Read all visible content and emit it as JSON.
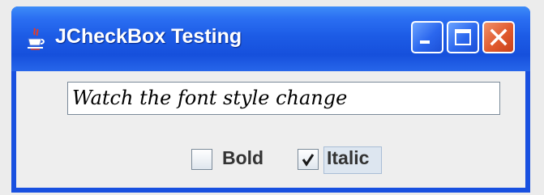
{
  "window": {
    "title": "JCheckBox Testing",
    "icon": "java-cup-icon",
    "controls": [
      "minimize-icon",
      "maximize-icon",
      "close-icon"
    ]
  },
  "textfield": {
    "value": "Watch the font style change"
  },
  "checkboxes": [
    {
      "label": "Bold",
      "checked": false
    },
    {
      "label": "Italic",
      "checked": true,
      "focused": true
    }
  ],
  "colors": {
    "titlebar": "#1d5ce6",
    "close_button": "#e05a2e",
    "client_background": "#eeeeee"
  }
}
